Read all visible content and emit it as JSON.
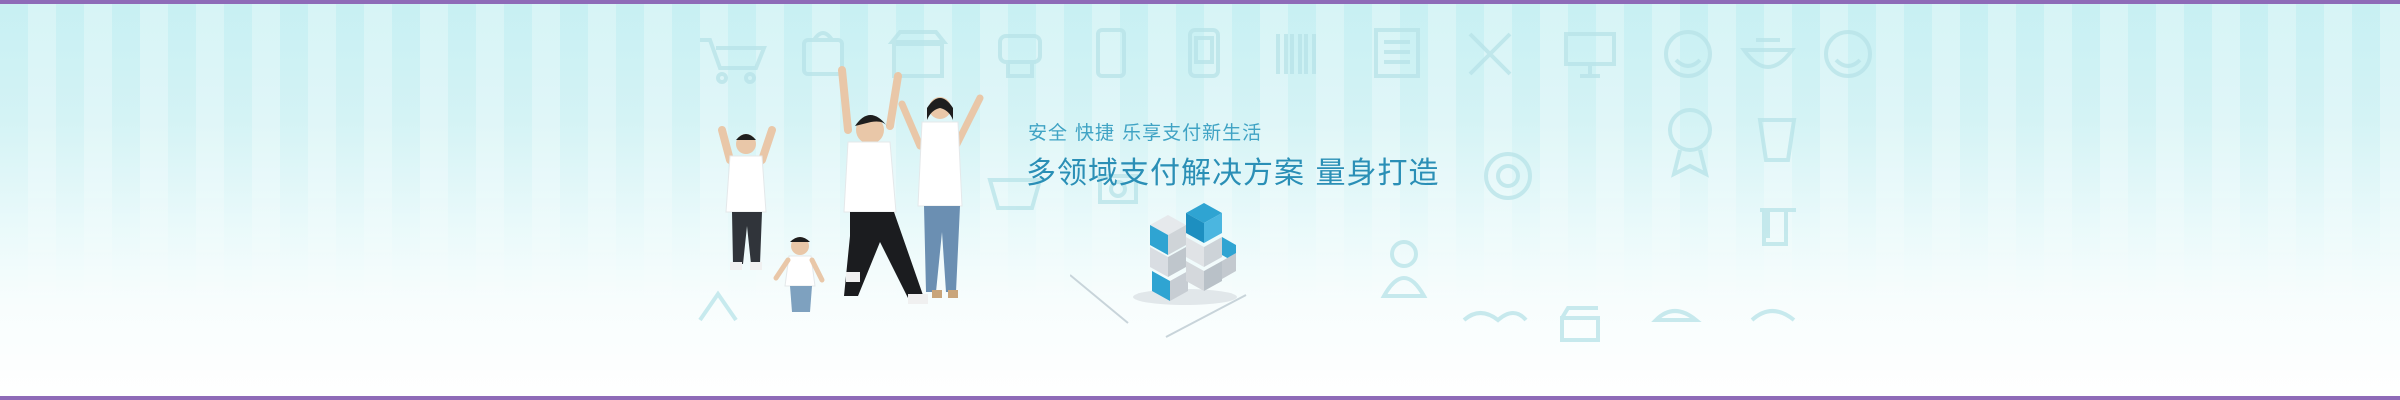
{
  "banner": {
    "tagline": "安全 快捷 乐享支付新生活",
    "headline": "多领域支付解决方案 量身打造"
  },
  "colors": {
    "frame": "#8e6bb8",
    "text_primary": "#2a8fb6",
    "text_secondary": "#3fa3c4",
    "background_top": "#c7f0f3",
    "background_bottom": "#ffffff",
    "cube_blue": "#2fa4d2",
    "cube_grey": "#d9dde2"
  },
  "decorative_icons": [
    "cart-icon",
    "bag-icon",
    "shop-icon",
    "phone-icon",
    "mobile-icon",
    "barcode-icon",
    "document-icon",
    "tools-icon",
    "desktop-icon",
    "smiley-icon",
    "bowl-icon",
    "smile-face-icon",
    "person-icon",
    "car-icon",
    "camera-icon",
    "handshake-icon",
    "clapper-icon",
    "cap-icon",
    "bottle-icon",
    "badge-icon",
    "medal-icon"
  ]
}
